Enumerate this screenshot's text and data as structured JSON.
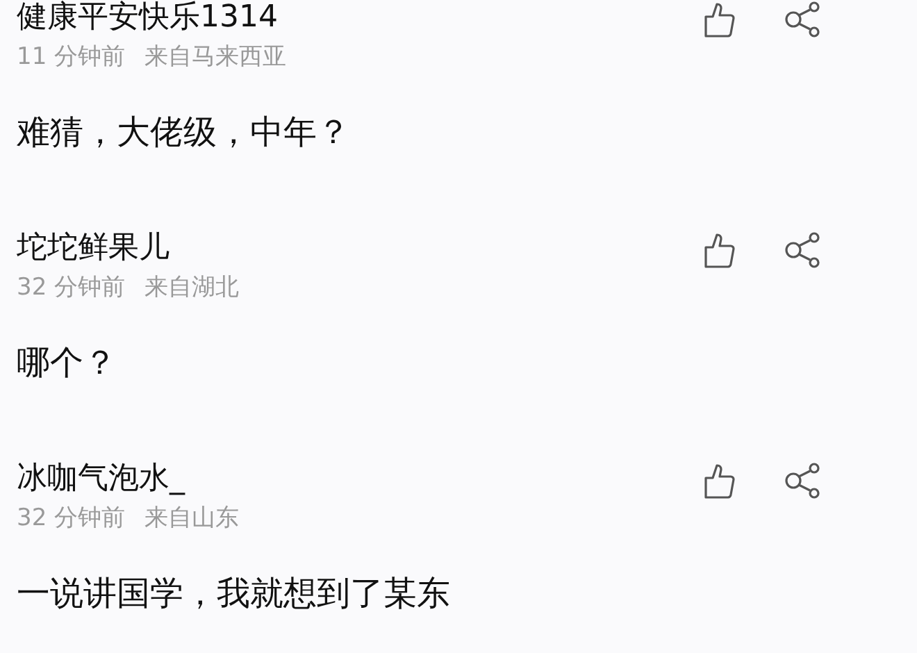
{
  "comments": [
    {
      "author": "健康平安快乐1314",
      "time": "11 分钟前",
      "location": "来自马来西亚",
      "text": "难猜，大佬级，中年？"
    },
    {
      "author": "坨坨鲜果儿",
      "time": "32 分钟前",
      "location": "来自湖北",
      "text": "哪个？"
    },
    {
      "author": "冰咖气泡水_",
      "time": "32 分钟前",
      "location": "来自山东",
      "text": "一说讲国学，我就想到了某东"
    }
  ]
}
